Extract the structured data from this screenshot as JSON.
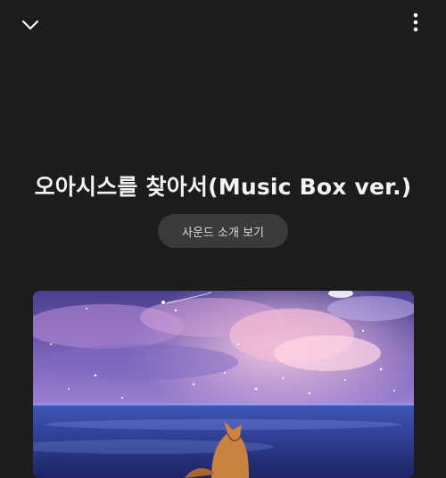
{
  "header": {
    "back_icon": "chevron-down-icon",
    "more_icon": "more-vertical-icon"
  },
  "track": {
    "title": "오아시스를 찾아서(Music Box ver.)",
    "sound_intro_button": "사운드 소개 보기"
  },
  "artwork": {
    "description_icon": "album-art-image",
    "colors": {
      "sky_top": "#5a4d9e",
      "cloud_pink": "#f4a8c8",
      "sea": "#2f3a8a",
      "fox": "#c9823f"
    }
  },
  "theme": {
    "background": "#1c1c1c",
    "pill_bg": "#3a3a3a"
  }
}
